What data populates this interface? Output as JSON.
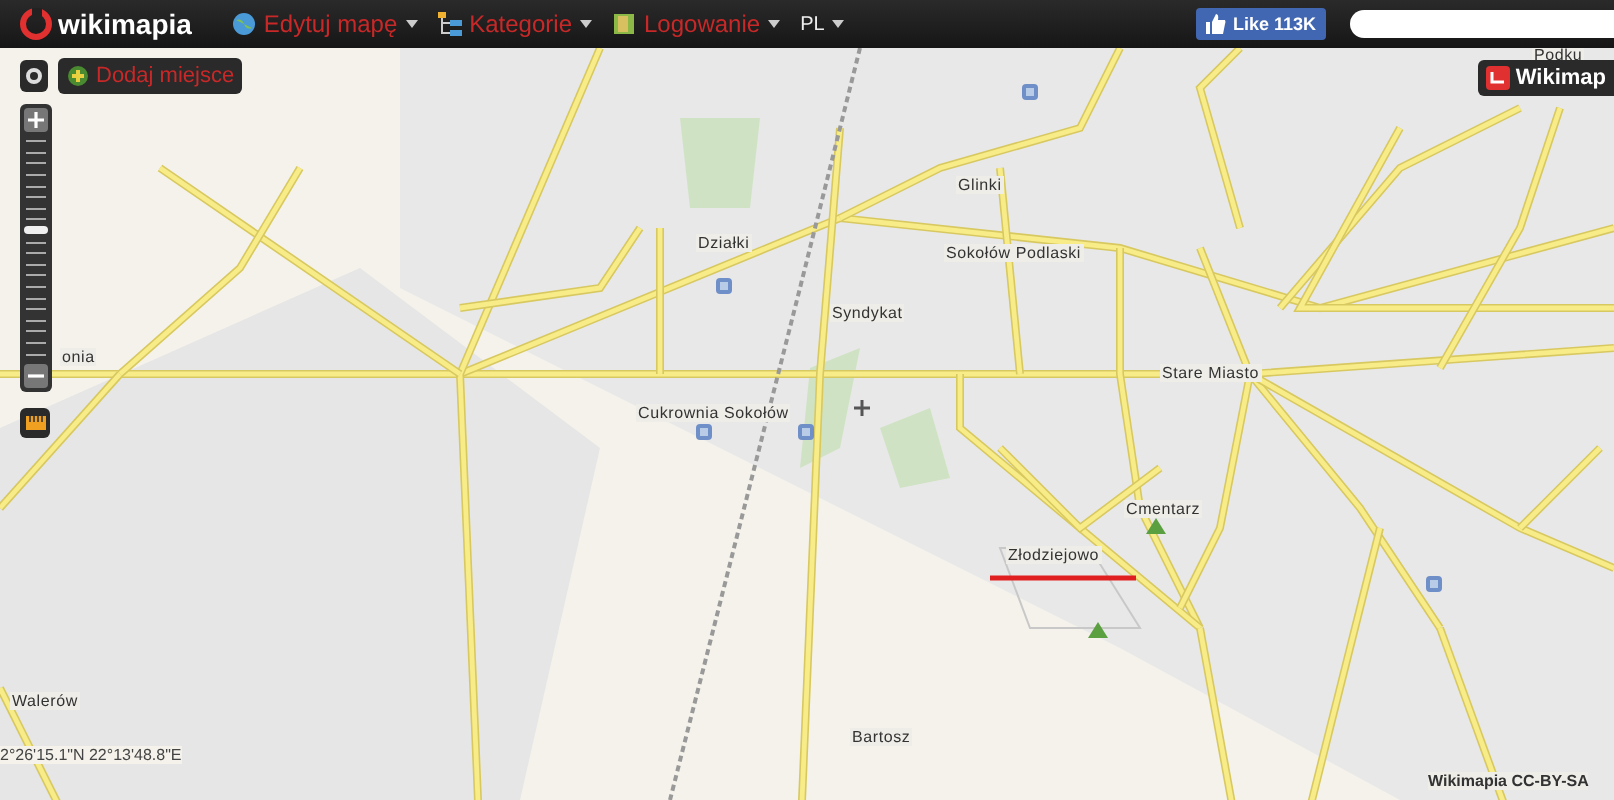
{
  "top_bar": {
    "logo": "wikimapia",
    "menu": [
      {
        "label": "Edytuj mapę"
      },
      {
        "label": "Kategorie"
      },
      {
        "label": "Logowanie"
      },
      {
        "label": "PL"
      }
    ],
    "like_button": {
      "label": "Like",
      "count": "113K"
    }
  },
  "map_controls": {
    "add_place_button": "Dodaj miejsce",
    "zoom": {
      "level": 0.58
    }
  },
  "map_labels": [
    {
      "text": "Podku"
    },
    {
      "text": "Glinki"
    },
    {
      "text": "Działki"
    },
    {
      "text": "Sokołów Podlaski"
    },
    {
      "text": "Syndykat"
    },
    {
      "text": "Stare Miasto"
    },
    {
      "text": "onia"
    },
    {
      "text": "Cukrownia Sokołów"
    },
    {
      "text": "Cmentarz"
    },
    {
      "text": "Złodziejowo"
    },
    {
      "text": "Walerów"
    },
    {
      "text": "Bartosz"
    }
  ],
  "corner_badge": "Wikimap",
  "coordinates": "2°26'15.1\"N 22°13'48.8\"E",
  "attribution": "Wikimapia CC-BY-SA"
}
